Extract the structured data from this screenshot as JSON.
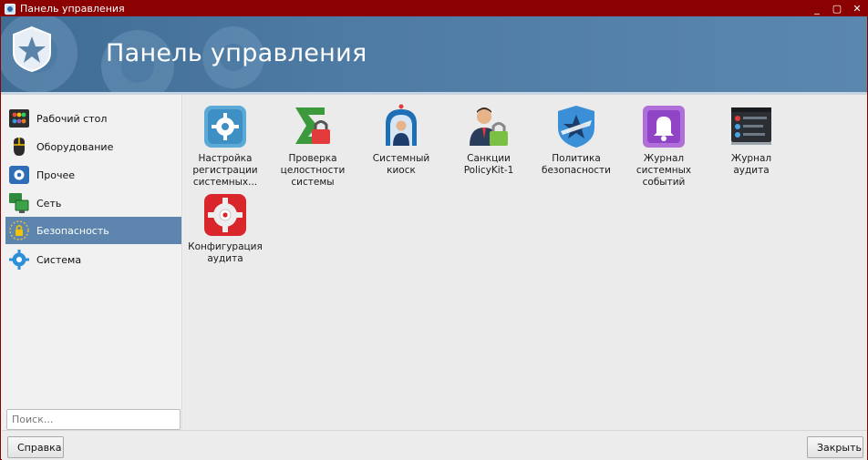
{
  "window": {
    "title": "Панель управления",
    "controls": [
      "_",
      "▢",
      "✕"
    ]
  },
  "banner": {
    "title": "Панель управления"
  },
  "sidebar": {
    "items": [
      {
        "label": "Рабочий стол",
        "icon": "desktop-icon"
      },
      {
        "label": "Оборудование",
        "icon": "mouse-icon"
      },
      {
        "label": "Прочее",
        "icon": "gear-box-icon"
      },
      {
        "label": "Сеть",
        "icon": "network-icon"
      },
      {
        "label": "Безопасность",
        "icon": "security-icon",
        "active": true
      },
      {
        "label": "Система",
        "icon": "system-gear-icon"
      }
    ],
    "search_placeholder": "Поиск..."
  },
  "tiles": [
    {
      "label": "Настройка регистрации системных...",
      "icon": "event-registration-gear-icon"
    },
    {
      "label": "Проверка целостности системы",
      "icon": "integrity-check-icon"
    },
    {
      "label": "Системный киоск",
      "icon": "kiosk-icon"
    },
    {
      "label": "Санкции PolicyKit-1",
      "icon": "policykit-user-lock-icon"
    },
    {
      "label": "Политика безопасности",
      "icon": "security-policy-shield-icon"
    },
    {
      "label": "Журнал системных событий",
      "icon": "system-events-bell-icon"
    },
    {
      "label": "Журнал аудита",
      "icon": "audit-log-icon"
    },
    {
      "label": "Конфигурация аудита",
      "icon": "audit-config-gear-icon"
    }
  ],
  "buttons": {
    "help": "Справка",
    "close": "Закрыть"
  },
  "colors": {
    "titlebar": "#8b0000",
    "banner": "#4e7ba3",
    "active": "#5d85ad"
  }
}
